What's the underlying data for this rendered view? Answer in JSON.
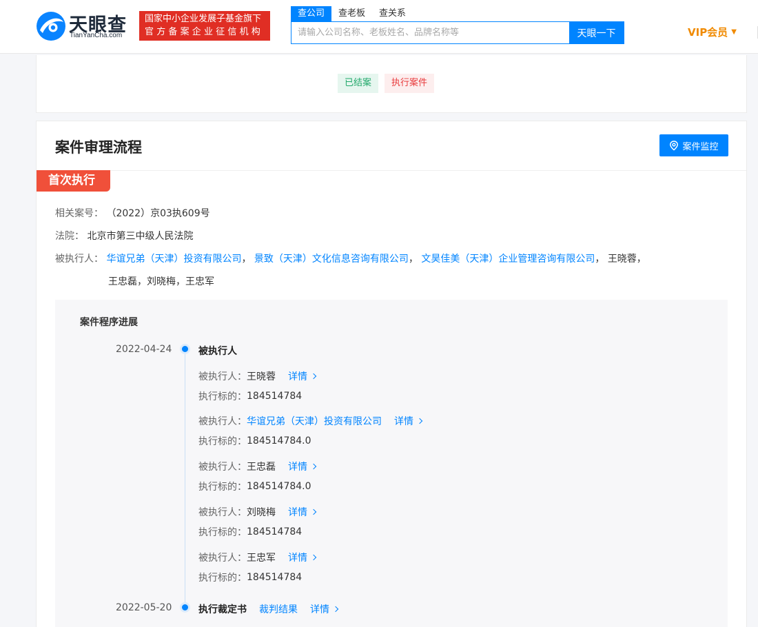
{
  "header": {
    "logo_text": "天眼查",
    "logo_sub": "TianYanCha.com",
    "gov_badge_line1": "国家中小企业发展子基金旗下",
    "gov_badge_line2": "官方备案企业征信机构",
    "search_tabs": [
      {
        "label": "查公司",
        "active": true
      },
      {
        "label": "查老板",
        "active": false
      },
      {
        "label": "查关系",
        "active": false
      }
    ],
    "search_placeholder": "请输入公司名称、老板姓名、品牌名称等",
    "search_button": "天眼一下",
    "vip_label": "VIP会员",
    "vip_caret": "▼"
  },
  "top_card": {
    "tag_closed": "已结案",
    "tag_exec": "执行案件"
  },
  "main": {
    "title": "案件审理流程",
    "monitor_button": "案件监控",
    "stage_tag": "首次执行",
    "case_no_label": "相关案号：",
    "case_no": "（2022）京03执609号",
    "court_label": "法院：",
    "court": "北京市第三中级人民法院",
    "executed_label": "被执行人：",
    "executed_companies": [
      "华谊兄弟（天津）投资有限公司",
      "景致（天津）文化信息咨询有限公司",
      "文昊佳美（天津）企业管理咨询有限公司"
    ],
    "sep": "，",
    "executed_person_inline": "王晓蓉，",
    "executed_persons_line2": "王忠磊，刘晓梅，王忠军"
  },
  "progress": {
    "title": "案件程序进展",
    "event1": {
      "date": "2022-04-24",
      "title": "被执行人",
      "entries": [
        {
          "label": "被执行人：",
          "name": "王晓蓉",
          "is_link": false,
          "detail": "详情",
          "amount_label": "执行标的：",
          "amount": "184514784"
        },
        {
          "label": "被执行人：",
          "name": "华谊兄弟（天津）投资有限公司",
          "is_link": true,
          "detail": "详情",
          "amount_label": "执行标的：",
          "amount": "184514784.0"
        },
        {
          "label": "被执行人：",
          "name": "王忠磊",
          "is_link": false,
          "detail": "详情",
          "amount_label": "执行标的：",
          "amount": "184514784.0"
        },
        {
          "label": "被执行人：",
          "name": "刘晓梅",
          "is_link": false,
          "detail": "详情",
          "amount_label": "执行标的：",
          "amount": "184514784"
        },
        {
          "label": "被执行人：",
          "name": "王忠军",
          "is_link": false,
          "detail": "详情",
          "amount_label": "执行标的：",
          "amount": "184514784"
        }
      ]
    },
    "event2": {
      "date": "2022-05-20",
      "title": "执行裁定书",
      "result": "裁判结果",
      "detail": "详情"
    }
  },
  "colors": {
    "brand_blue": "#0084ff",
    "gov_red": "#e02e24",
    "stage_red": "#f0503a",
    "vip_orange": "#f08a00"
  },
  "icons": [
    "tianyancha-logo-icon",
    "location-pin-icon",
    "chevron-right-icon",
    "caret-down-icon"
  ]
}
